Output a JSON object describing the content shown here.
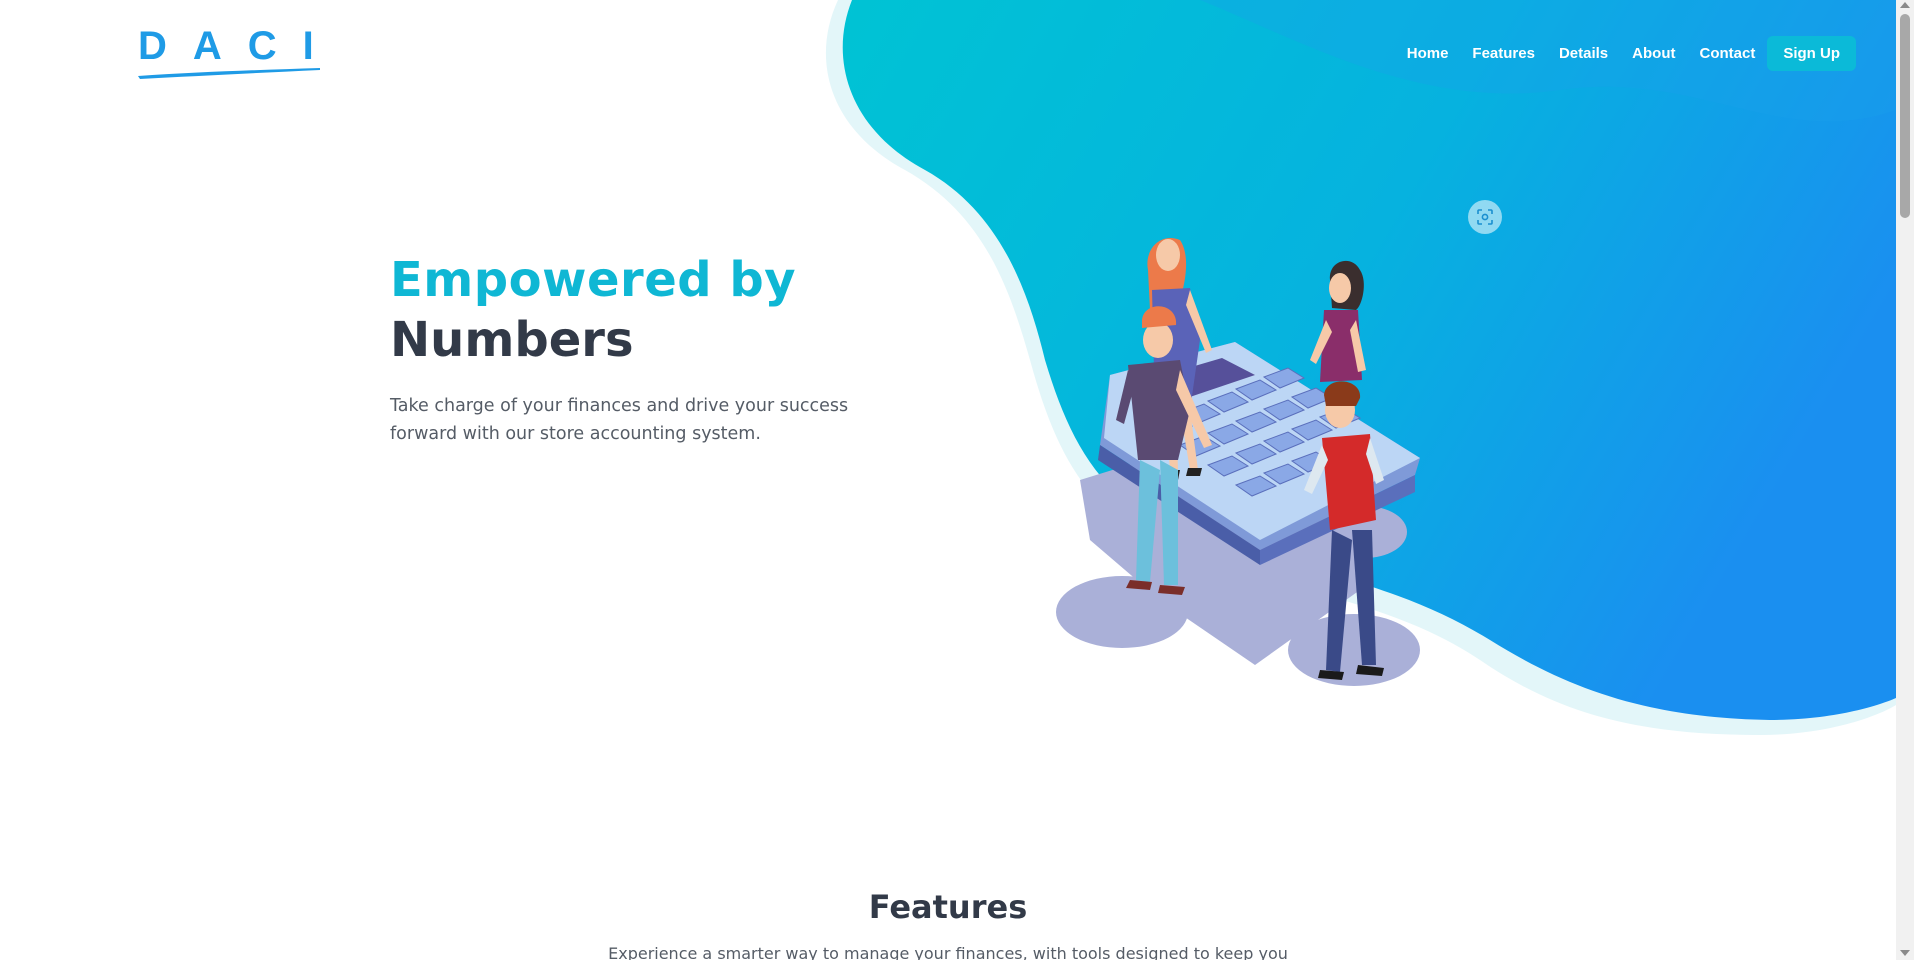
{
  "brand": {
    "logo_text": "DACI",
    "color": "#1f9be6"
  },
  "nav": {
    "items": [
      {
        "label": "Home"
      },
      {
        "label": "Features"
      },
      {
        "label": "Details"
      },
      {
        "label": "About"
      },
      {
        "label": "Contact"
      }
    ],
    "signup_label": "Sign Up"
  },
  "hero": {
    "title_line1": "Empowered by",
    "title_line2": "Numbers",
    "description": "Take charge of your finances and drive your success forward with our store accounting system.",
    "accent_color": "#0fb7d4",
    "illustration": "people-around-calculator-illustration"
  },
  "features": {
    "title": "Features",
    "subtitle": "Experience a smarter way to manage your finances, with tools designed to keep you"
  },
  "icons": {
    "screenshot": "screenshot-capture-icon"
  }
}
